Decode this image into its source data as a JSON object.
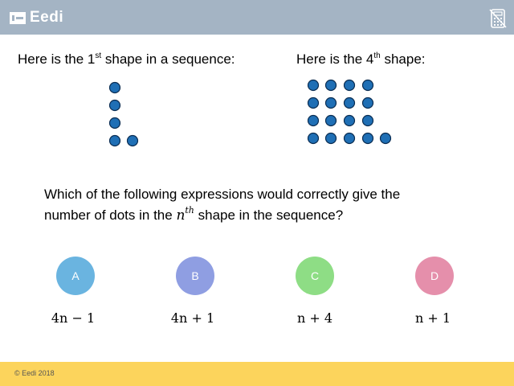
{
  "header": {
    "logo_text": "Eedi",
    "colors": {
      "background": "#a4b4c4",
      "footer": "#fcd45c"
    },
    "calculator_icon": "calculator-disabled-icon"
  },
  "prompts": {
    "left": {
      "pre": "Here is the 1",
      "sup": "st",
      "post": " shape in a sequence:"
    },
    "right": {
      "pre": "Here is the 4",
      "sup": "th",
      "post": " shape:"
    }
  },
  "dot_color": "#1f6fb5",
  "question": {
    "line1": "Which of the following expressions would correctly give the",
    "line2_pre": "number of dots in the ",
    "line2_var": "n",
    "line2_sup": "th",
    "line2_post": " shape in the sequence?"
  },
  "options": [
    {
      "letter": "A",
      "expression": "4n − 1",
      "color": "#6ab4e0"
    },
    {
      "letter": "B",
      "expression": "4n + 1",
      "color": "#8f9ee2"
    },
    {
      "letter": "C",
      "expression": "n + 4",
      "color": "#8edd85"
    },
    {
      "letter": "D",
      "expression": "n + 1",
      "color": "#e58fab"
    }
  ],
  "footer": {
    "text": "© Eedi 2018"
  }
}
